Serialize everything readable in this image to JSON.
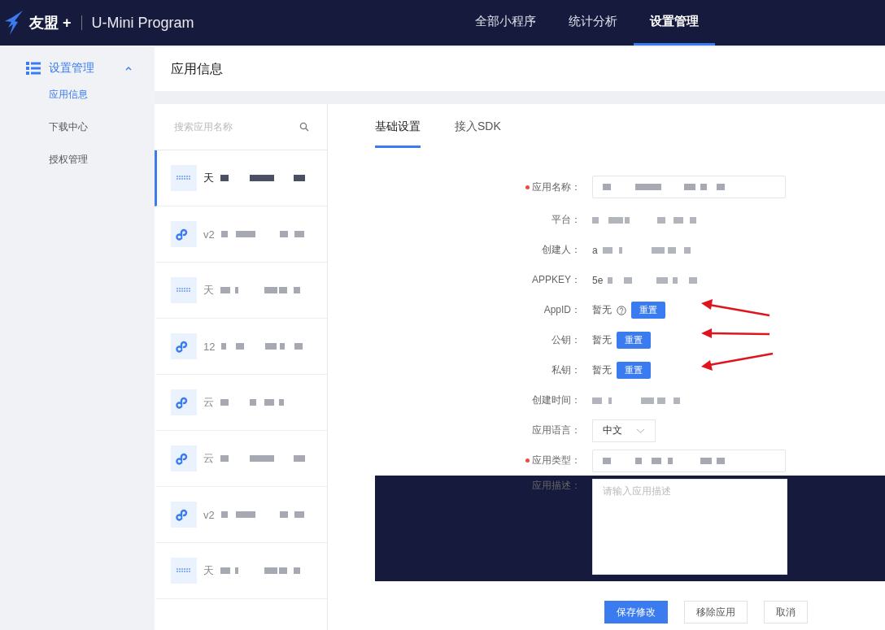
{
  "header": {
    "brand": "友盟 +",
    "product": "U-Mini Program",
    "nav": [
      {
        "label": "全部小程序",
        "selected": false
      },
      {
        "label": "统计分析",
        "selected": false
      },
      {
        "label": "设置管理",
        "selected": true
      }
    ]
  },
  "sidebar": {
    "group": {
      "label": "设置管理",
      "expanded": true
    },
    "items": [
      {
        "label": "应用信息",
        "selected": true
      },
      {
        "label": "下载中心",
        "selected": false
      },
      {
        "label": "授权管理",
        "selected": false
      }
    ]
  },
  "page_title": "应用信息",
  "app_list": {
    "search_placeholder": "搜索应用名称",
    "items": [
      {
        "kind": "logo",
        "name": "天",
        "selected": true
      },
      {
        "kind": "link",
        "name": "v2",
        "selected": false
      },
      {
        "kind": "logo",
        "name": "天",
        "selected": false
      },
      {
        "kind": "link",
        "name": "12",
        "selected": false
      },
      {
        "kind": "link",
        "name": "云",
        "selected": false
      },
      {
        "kind": "link",
        "name": "云",
        "selected": false
      },
      {
        "kind": "link",
        "name": "v2",
        "selected": false
      },
      {
        "kind": "logo",
        "name": "天",
        "selected": false
      }
    ]
  },
  "tabs": [
    {
      "label": "基础设置",
      "selected": true
    },
    {
      "label": "接入SDK",
      "selected": false
    }
  ],
  "form": {
    "rows": [
      {
        "kind": "input",
        "label": "应用名称：",
        "required": true
      },
      {
        "kind": "text",
        "label": "平台：",
        "required": false
      },
      {
        "kind": "text",
        "label": "创建人：",
        "value": "a",
        "required": false
      },
      {
        "kind": "text",
        "label": "APPKEY：",
        "value": "5e",
        "required": false
      },
      {
        "kind": "reset",
        "label": "AppID：",
        "value": "暂无",
        "help": true,
        "button": "重置",
        "required": false
      },
      {
        "kind": "reset",
        "label": "公钥：",
        "value": "暂无",
        "help": false,
        "button": "重置",
        "required": false
      },
      {
        "kind": "reset",
        "label": "私钥：",
        "value": "暂无",
        "help": false,
        "button": "重置",
        "required": false
      },
      {
        "kind": "text",
        "label": "创建时间：",
        "required": false
      },
      {
        "kind": "select",
        "label": "应用语言：",
        "value": "中文",
        "required": false
      },
      {
        "kind": "input",
        "label": "应用类型：",
        "required": true
      },
      {
        "kind": "textarea",
        "label": "应用描述：",
        "placeholder": "请输入应用描述",
        "required": false
      }
    ],
    "actions": [
      {
        "label": "保存修改",
        "primary": true
      },
      {
        "label": "移除应用",
        "primary": false
      },
      {
        "label": "取消",
        "primary": false
      }
    ]
  }
}
